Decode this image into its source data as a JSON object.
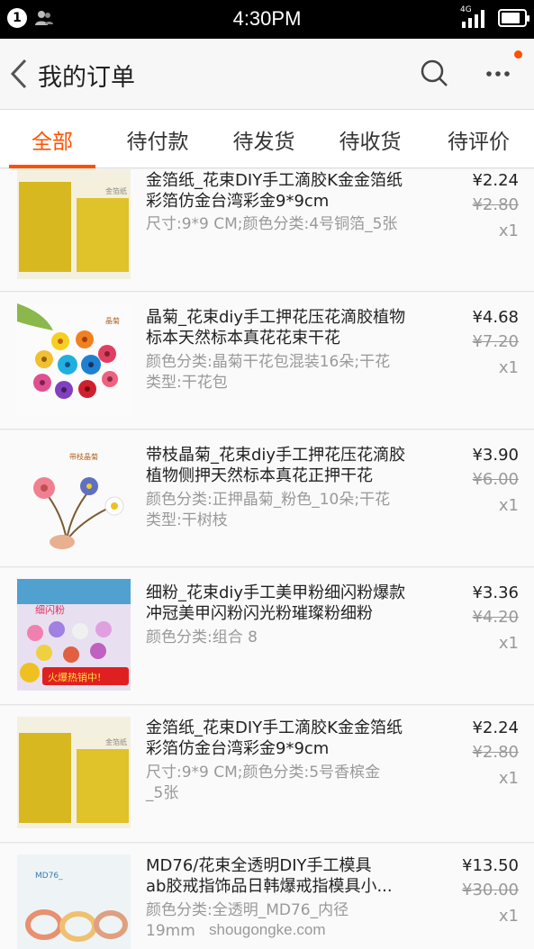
{
  "status_bar": {
    "badge": "1",
    "time": "4:30PM",
    "network": "4G",
    "battery_level": 0.85
  },
  "header": {
    "title": "我的订单"
  },
  "tabs": [
    {
      "label": "全部",
      "active": true
    },
    {
      "label": "待付款",
      "active": false
    },
    {
      "label": "待发货",
      "active": false
    },
    {
      "label": "待收货",
      "active": false
    },
    {
      "label": "待评价",
      "active": false
    }
  ],
  "orders": [
    {
      "title_line1": "金箔纸_花束DIY手工滴胶K金金箔纸",
      "title_line2": "彩箔仿金台湾彩金9*9cm",
      "sku_line1": "尺寸:9*9 CM;颜色分类:4号铜箔_5张",
      "sku_line2": "",
      "price": "¥2.24",
      "original_price": "¥2.80",
      "quantity": "x1",
      "thumb_icon": "gold-foil-thumbnail",
      "thumb_caption": "金箔纸"
    },
    {
      "title_line1": "晶菊_花束diy手工押花压花滴胶植物",
      "title_line2": "标本天然标本真花花束干花",
      "sku_line1": "颜色分类:晶菊干花包混装16朵;干花",
      "sku_line2": "类型:干花包",
      "price": "¥4.68",
      "original_price": "¥7.20",
      "quantity": "x1",
      "thumb_icon": "dried-flowers-thumbnail",
      "thumb_caption": "晶菊"
    },
    {
      "title_line1": "带枝晶菊_花束diy手工押花压花滴胶",
      "title_line2": "植物侧押天然标本真花正押干花",
      "sku_line1": "颜色分类:正押晶菊_粉色_10朵;干花",
      "sku_line2": "类型:干树枝",
      "price": "¥3.90",
      "original_price": "¥6.00",
      "quantity": "x1",
      "thumb_icon": "flower-branch-thumbnail",
      "thumb_caption": "带枝晶菊"
    },
    {
      "title_line1": "细粉_花束diy手工美甲粉细闪粉爆款",
      "title_line2": "冲冠美甲闪粉闪光粉璀璨粉细粉",
      "sku_line1": "颜色分类:组合 8",
      "sku_line2": "",
      "price": "¥3.36",
      "original_price": "¥4.20",
      "quantity": "x1",
      "thumb_icon": "glitter-powder-thumbnail",
      "thumb_caption": "细闪粉",
      "thumb_banner": "火爆热销中!"
    },
    {
      "title_line1": "金箔纸_花束DIY手工滴胶K金金箔纸",
      "title_line2": "彩箔仿金台湾彩金9*9cm",
      "sku_line1": "尺寸:9*9 CM;颜色分类:5号香槟金",
      "sku_line2": "_5张",
      "price": "¥2.24",
      "original_price": "¥2.80",
      "quantity": "x1",
      "thumb_icon": "gold-foil-thumbnail",
      "thumb_caption": "金箔纸"
    },
    {
      "title_line1": "MD76/花束全透明DIY手工模具",
      "title_line2": "ab胶戒指饰品日韩爆戒指模具小...",
      "sku_line1": "颜色分类:全透明_MD76_内径",
      "sku_line2": "19mm",
      "price": "¥13.50",
      "original_price": "¥30.00",
      "quantity": "x1",
      "thumb_icon": "ring-mold-thumbnail",
      "thumb_caption": "MD76_"
    }
  ],
  "watermark": "shougongke.com"
}
